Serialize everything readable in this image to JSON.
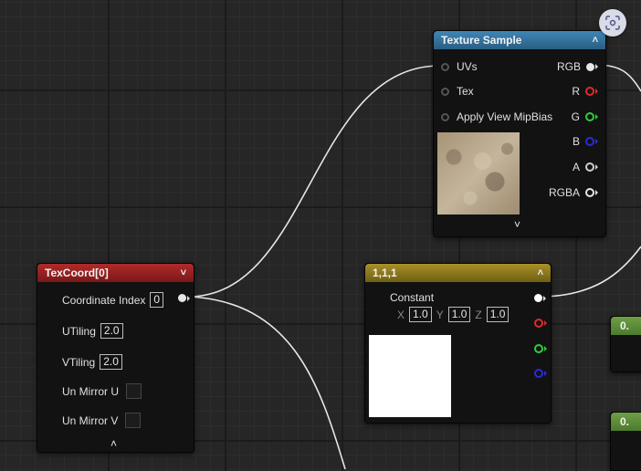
{
  "texture_sample": {
    "title": "Texture Sample",
    "inputs": [
      "UVs",
      "Tex",
      "Apply View MipBias"
    ],
    "outputs": [
      "RGB",
      "R",
      "G",
      "B",
      "A",
      "RGBA"
    ],
    "output_colors": [
      "#e6e6e6",
      "#e02a2a",
      "#2ecf3a",
      "#2b2bdc",
      "#cfcfcf",
      "#e6e6e6"
    ],
    "header_color": "#2f6b93",
    "collapse_icon": "chevron-up-icon",
    "expand_icon": "chevron-down-icon"
  },
  "texcoord": {
    "title": "TexCoord[0]",
    "header_color": "#8e1e1e",
    "coordinate_index_label": "Coordinate Index",
    "coordinate_index_value": "0",
    "utiling_label": "UTiling",
    "utiling_value": "2.0",
    "vtiling_label": "VTiling",
    "vtiling_value": "2.0",
    "un_mirror_u_label": "Un Mirror U",
    "un_mirror_v_label": "Un Mirror V"
  },
  "constant": {
    "title": "1,1,1",
    "header_color": "#8f7d1e",
    "label": "Constant",
    "x_label": "X",
    "x_value": "1.0",
    "y_label": "Y",
    "y_value": "1.0",
    "z_label": "Z",
    "z_value": "1.0",
    "output_colors": [
      "#ffffff",
      "#e02a2a",
      "#2ecf3a",
      "#2b2bdc"
    ]
  },
  "partial_nodes": [
    {
      "title": "0.",
      "header_color": "#5d8a3a"
    },
    {
      "title": "0.",
      "header_color": "#5d8a3a"
    }
  ],
  "screenshot_button_icon": "scan-icon"
}
